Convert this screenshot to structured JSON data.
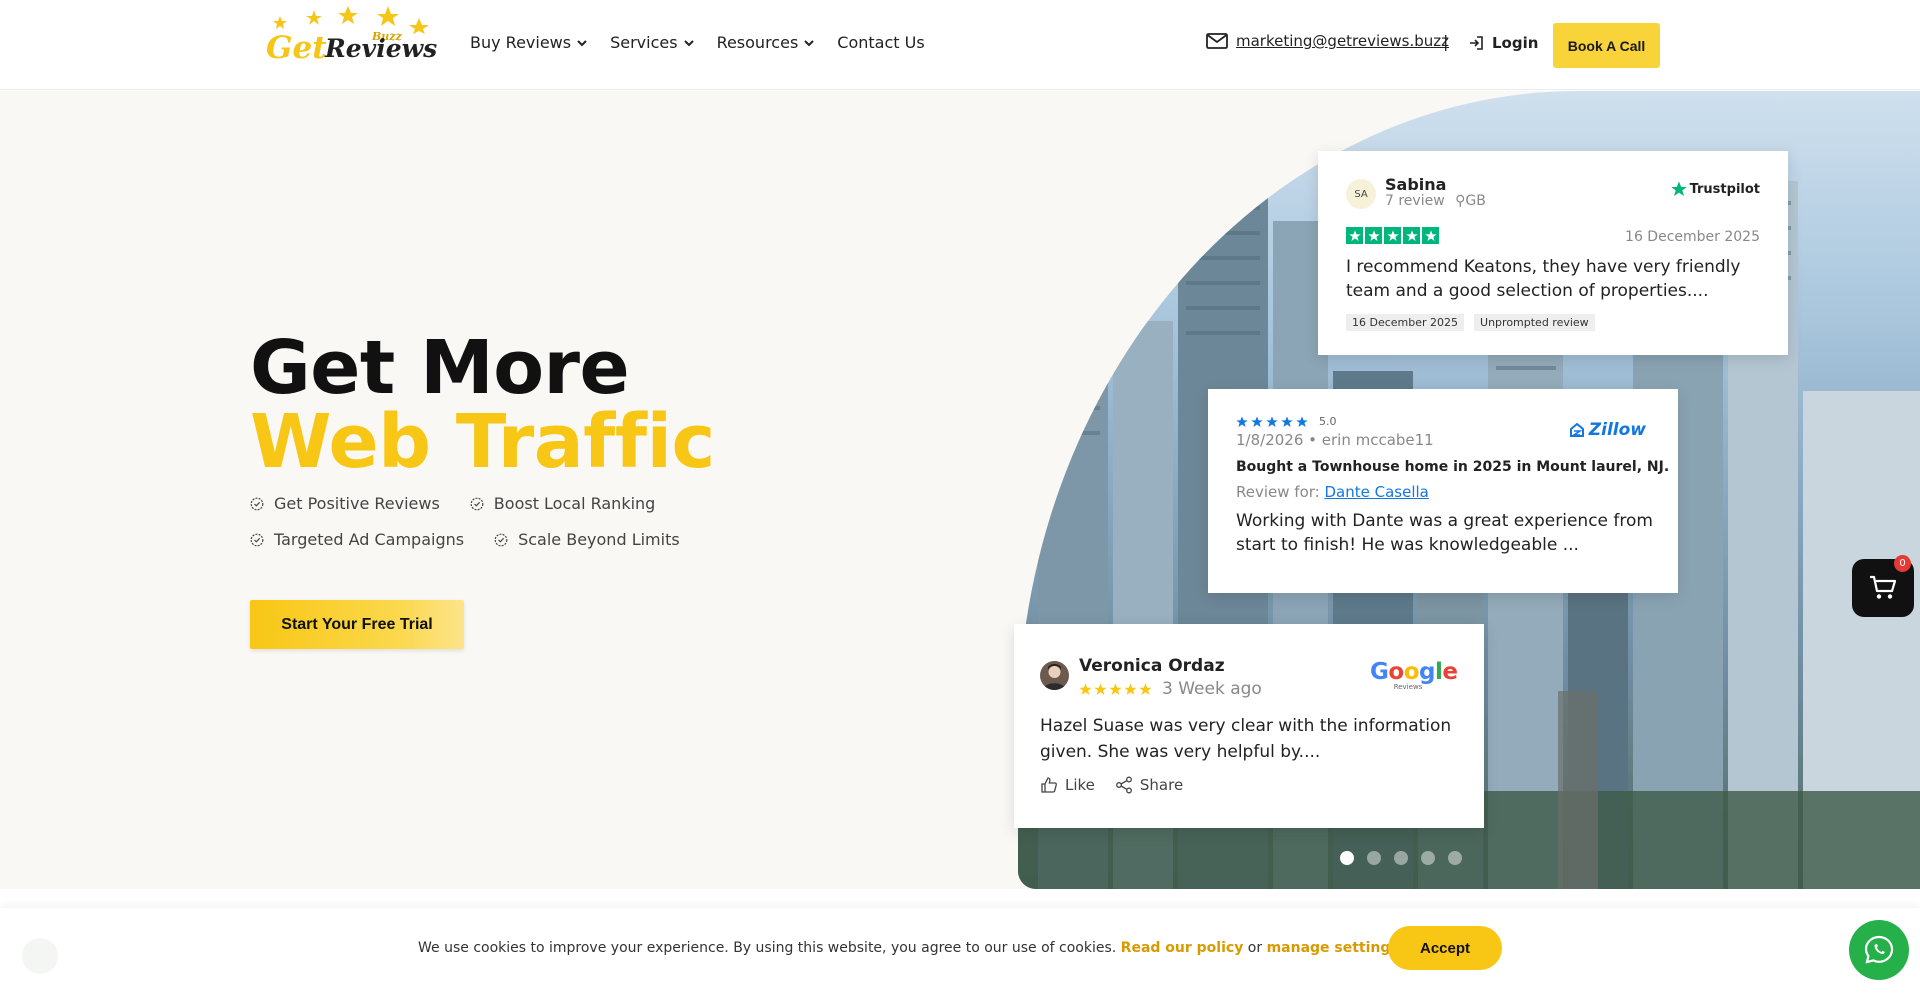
{
  "header": {
    "logo": {
      "word1": "Get",
      "word2": "Reviews",
      "word3": "Buzz"
    },
    "nav": [
      {
        "label": "Buy Reviews",
        "dropdown": true
      },
      {
        "label": "Services",
        "dropdown": true
      },
      {
        "label": "Resources",
        "dropdown": true
      },
      {
        "label": "Contact Us",
        "dropdown": false
      }
    ],
    "email": "marketing@getreviews.buzz",
    "separator": "|",
    "login_label": "Login",
    "book_label": "Book A Call"
  },
  "hero": {
    "headline_line1": "Get More",
    "headline_line2": "Web Traffic",
    "features": [
      "Get Positive Reviews",
      "Boost Local Ranking",
      "Targeted Ad Campaigns",
      "Scale Beyond Limits"
    ],
    "cta_label": "Start Your Free Trial"
  },
  "reviews": {
    "trustpilot": {
      "initials": "SA",
      "name": "Sabina",
      "count": "7 review",
      "country": "GB",
      "brand": "Trustpilot",
      "rating": 5,
      "date": "16 December 2025",
      "text": "I recommend Keatons, they have very friendly team and a good selection of properties....",
      "tags": [
        "16 December 2025",
        "Unprompted review"
      ]
    },
    "zillow": {
      "rating_text": "5.0",
      "brand": "Zillow",
      "meta": "1/8/2026 • erin mccabe11",
      "title": "Bought a Townhouse home in 2025 in Mount laurel, NJ.",
      "review_for_label": "Review for:",
      "agent": "Dante Casella",
      "text": "Working with Dante was a great experience from start to finish! He was knowledgeable ..."
    },
    "google": {
      "name": "Veronica Ordaz",
      "time_ago": "3 Week ago",
      "brand_word": "Google",
      "brand_sub": "Reviews",
      "text": "Hazel Suase was very clear with the information given. She was very helpful by....",
      "like_label": "Like",
      "share_label": "Share"
    },
    "slider": {
      "total": 5,
      "active": 1
    }
  },
  "cart": {
    "count": "0"
  },
  "cookie": {
    "text_prefix": "We use cookies to improve your experience. By using this website, you agree to our use of cookies.",
    "policy_link": "Read our policy",
    "conjunction": "or",
    "settings_link": "manage settings",
    "accept_label": "Accept"
  },
  "colors": {
    "accent_yellow": "#f8c614",
    "trustpilot_green": "#00b67a",
    "zillow_blue": "#1277e1",
    "whatsapp_green": "#25b04a"
  },
  "icons": [
    "mail-icon",
    "login-icon",
    "chevron-down-icon",
    "check-badge-icon",
    "trustpilot-star-icon",
    "zillow-house-icon",
    "like-icon",
    "share-icon",
    "cart-icon",
    "chat-icon"
  ]
}
